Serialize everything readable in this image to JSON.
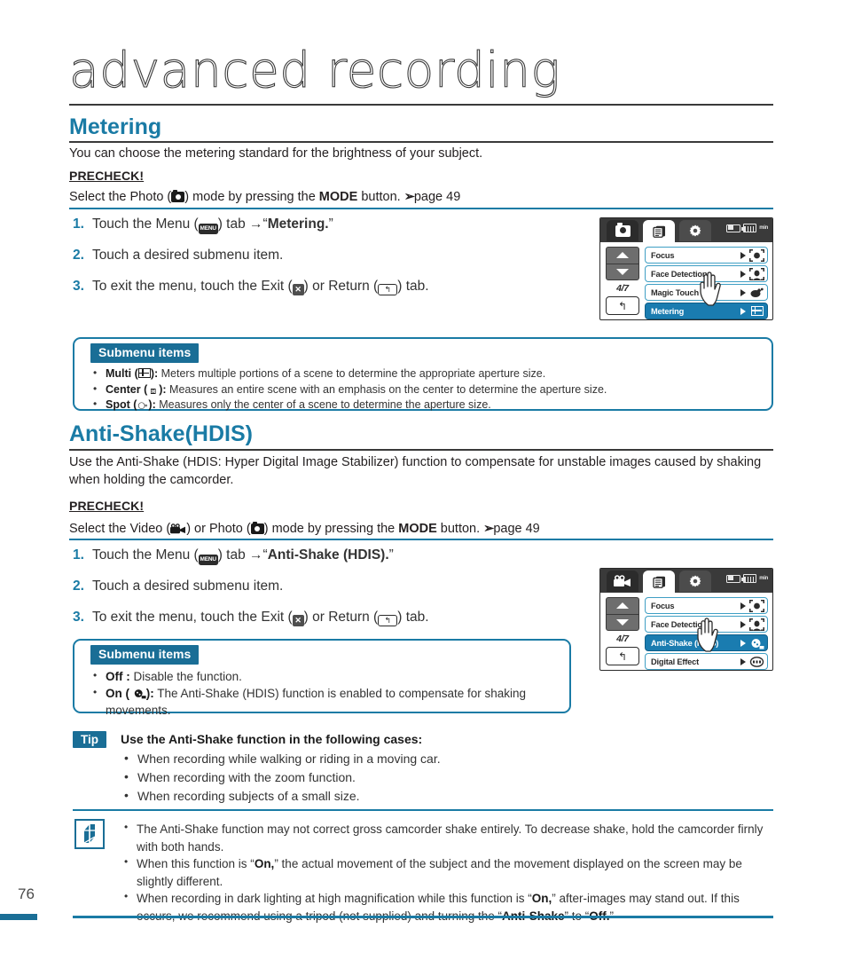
{
  "chapter": {
    "title": "advanced recording"
  },
  "page": {
    "number": "76"
  },
  "sections": [
    {
      "id": "metering",
      "heading": "Metering",
      "intro": "You can choose the metering standard for the brightness of your subject.",
      "precheck_label": "PRECHECK!",
      "precheck_pre": "Select the Photo (",
      "precheck_mid": ") mode by pressing the ",
      "precheck_bold": "MODE",
      "precheck_post": " button. ",
      "precheck_page": "page 49",
      "steps": [
        {
          "num": "1.",
          "pre": "Touch the Menu (",
          "icon": "MENU",
          "mid": ") tab ",
          "arrow": "→",
          "quote": "“",
          "bold": "Metering.",
          "quote_end": "”"
        },
        {
          "num": "2.",
          "text": "Touch a desired submenu item."
        },
        {
          "num": "3.",
          "pre": "To exit the menu, touch the Exit (",
          "mid": ") or Return (",
          "post": ") tab."
        }
      ],
      "submenu": {
        "badge": "Submenu items",
        "items": [
          {
            "name": "Multi",
            "icon": "multi-meter-icon",
            "desc": "Meters multiple portions of a scene to determine the appropriate aperture size."
          },
          {
            "name": "Center",
            "icon": "center-meter-icon",
            "desc": "Measures an entire scene with an emphasis on the center to determine the aperture size."
          },
          {
            "name": "Spot",
            "icon": "spot-meter-icon",
            "desc": "Measures only the center of a scene to determine the aperture size."
          }
        ]
      }
    },
    {
      "id": "anti-shake",
      "heading": "Anti-Shake(HDIS)",
      "intro": "Use the Anti-Shake (HDIS: Hyper Digital Image Stabilizer) function to compensate for unstable images caused by shaking when holding the camcorder.",
      "precheck_label": "PRECHECK!",
      "precheck_pre": "Select the Video (",
      "precheck_or": ") or Photo (",
      "precheck_mid": ") mode by pressing the ",
      "precheck_bold": "MODE",
      "precheck_post": " button. ",
      "precheck_page": "page 49",
      "steps": [
        {
          "num": "1.",
          "pre": "Touch the Menu (",
          "icon": "MENU",
          "mid": ") tab ",
          "arrow": "→",
          "quote": "“",
          "bold": "Anti-Shake (HDIS).",
          "quote_end": "”"
        },
        {
          "num": "2.",
          "text": "Touch a desired submenu item."
        },
        {
          "num": "3.",
          "pre": "To exit the menu, touch the Exit (",
          "mid": ") or Return (",
          "post": ") tab."
        }
      ],
      "submenu": {
        "badge": "Submenu items",
        "items": [
          {
            "name": "Off :",
            "desc": "Disable the function."
          },
          {
            "name": "On (",
            "icon": "anti-shake-icon",
            "name_end": "):",
            "desc": "The Anti-Shake (HDIS) function is enabled to compensate for shaking movements."
          }
        ]
      }
    }
  ],
  "lcd_screens": [
    {
      "id": "metering-lcd",
      "tabs": [
        {
          "name": "photo-mode-tab",
          "icon": "photo-camera-icon",
          "active": false
        },
        {
          "name": "menu-list-tab",
          "icon": "list-icon",
          "active": true
        },
        {
          "name": "settings-tab",
          "icon": "gear-icon",
          "active": false
        }
      ],
      "status": {
        "battery": "battery-icon",
        "card": "storage-icon",
        "time": "min"
      },
      "nav": {
        "up": "chevron-up-icon",
        "down": "chevron-down-icon",
        "counter": "4/7",
        "return": "return-icon"
      },
      "rows": [
        {
          "label": "Focus",
          "selected": false,
          "icon": "focus-icon"
        },
        {
          "label": "Face Detection",
          "selected": false,
          "icon": "face-detection-icon"
        },
        {
          "label": "Magic Touch",
          "selected": false,
          "icon": "magic-touch-icon"
        },
        {
          "label": "Metering",
          "selected": true,
          "icon": "metering-icon"
        }
      ],
      "cursor": "hand-pointer"
    },
    {
      "id": "anti-shake-lcd",
      "tabs": [
        {
          "name": "video-mode-tab",
          "icon": "video-camera-icon",
          "active": false
        },
        {
          "name": "menu-list-tab",
          "icon": "list-icon",
          "active": true
        },
        {
          "name": "settings-tab",
          "icon": "gear-icon",
          "active": false
        }
      ],
      "status": {
        "battery": "battery-icon",
        "card": "storage-icon",
        "time": "min"
      },
      "nav": {
        "up": "chevron-up-icon",
        "down": "chevron-down-icon",
        "counter": "4/7",
        "return": "return-icon"
      },
      "rows": [
        {
          "label": "Focus",
          "selected": false,
          "icon": "focus-icon"
        },
        {
          "label": "Face Detection",
          "selected": false,
          "icon": "face-detection-icon"
        },
        {
          "label": "Anti-Shake (HDIS)",
          "selected": true,
          "icon": "anti-shake-icon"
        },
        {
          "label": "Digital Effect",
          "selected": false,
          "icon": "digital-effect-icon"
        }
      ],
      "cursor": "hand-pointer"
    }
  ],
  "tip": {
    "badge": "Tip",
    "title": "Use the Anti-Shake function in the following cases:",
    "items": [
      "When recording while walking or riding in a moving car.",
      "When recording with the zoom function.",
      "When recording subjects of a small size."
    ]
  },
  "notes": {
    "icon": "note-pencil-icon",
    "items": [
      {
        "a": "The Anti-Shake function may not correct gross camcorder shake entirely. To decrease shake, hold the camcorder firnly with both hands."
      },
      {
        "a": "When this function is “",
        "b1": "On,",
        "c": "” the actual movement of the subject and the movement displayed on the screen may be slightly different."
      },
      {
        "a": "When recording in dark lighting at high magnification while this function is “",
        "b1": "On,",
        "c": "” after-images may stand out. If this occurs, we recommend using a tripod (not supplied) and turning the “",
        "b2": "Anti-Shake",
        "d": "” to “",
        "b3": "Off.",
        "e": "”"
      }
    ]
  },
  "colors": {
    "accent": "#1a7ba5",
    "badge": "#1a6e96",
    "lcd_selected": "#1a7cb0",
    "text": "#231f20"
  }
}
